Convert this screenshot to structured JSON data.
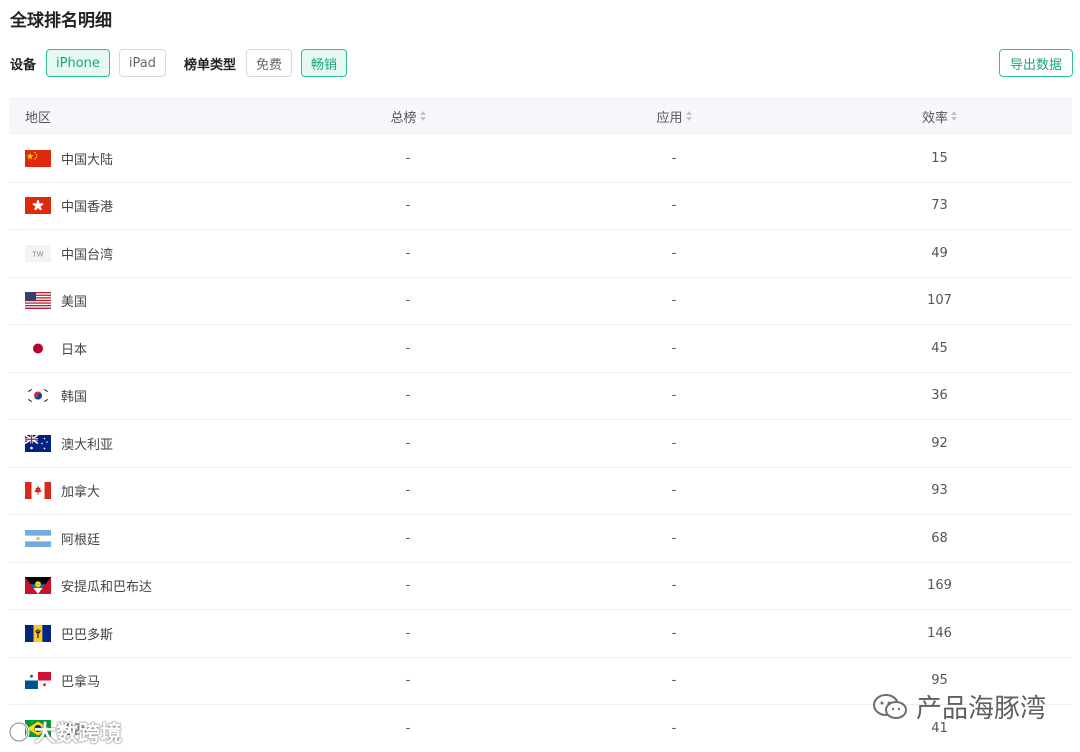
{
  "title": "全球排名明细",
  "filters": {
    "device_label": "设备",
    "devices": [
      {
        "label": "iPhone",
        "active": true
      },
      {
        "label": "iPad",
        "active": false
      }
    ],
    "chart_type_label": "榜单类型",
    "chart_types": [
      {
        "label": "免费",
        "active": false
      },
      {
        "label": "畅销",
        "active": true
      }
    ]
  },
  "export_label": "导出数据",
  "table": {
    "headers": [
      "地区",
      "总榜",
      "应用",
      "效率"
    ],
    "rows": [
      {
        "flag": "cn-flag-icon",
        "region": "中国大陆",
        "total": "-",
        "app": "-",
        "efficiency": "15"
      },
      {
        "flag": "hk-flag-icon",
        "region": "中国香港",
        "total": "-",
        "app": "-",
        "efficiency": "73"
      },
      {
        "flag": "tw-flag-icon",
        "flag_text": "TW",
        "region": "中国台湾",
        "total": "-",
        "app": "-",
        "efficiency": "49"
      },
      {
        "flag": "us-flag-icon",
        "region": "美国",
        "total": "-",
        "app": "-",
        "efficiency": "107"
      },
      {
        "flag": "jp-flag-icon",
        "region": "日本",
        "total": "-",
        "app": "-",
        "efficiency": "45"
      },
      {
        "flag": "kr-flag-icon",
        "region": "韩国",
        "total": "-",
        "app": "-",
        "efficiency": "36"
      },
      {
        "flag": "au-flag-icon",
        "region": "澳大利亚",
        "total": "-",
        "app": "-",
        "efficiency": "92"
      },
      {
        "flag": "ca-flag-icon",
        "region": "加拿大",
        "total": "-",
        "app": "-",
        "efficiency": "93"
      },
      {
        "flag": "ar-flag-icon",
        "region": "阿根廷",
        "total": "-",
        "app": "-",
        "efficiency": "68"
      },
      {
        "flag": "ag-flag-icon",
        "region": "安提瓜和巴布达",
        "total": "-",
        "app": "-",
        "efficiency": "169"
      },
      {
        "flag": "bb-flag-icon",
        "region": "巴巴多斯",
        "total": "-",
        "app": "-",
        "efficiency": "146"
      },
      {
        "flag": "pa-flag-icon",
        "region": "巴拿马",
        "total": "-",
        "app": "-",
        "efficiency": "95"
      },
      {
        "flag": "br-flag-icon",
        "region": "巴西",
        "total": "-",
        "app": "-",
        "efficiency": "41"
      }
    ]
  },
  "watermark_right": "产品海豚湾",
  "watermark_left": "大数跨境"
}
